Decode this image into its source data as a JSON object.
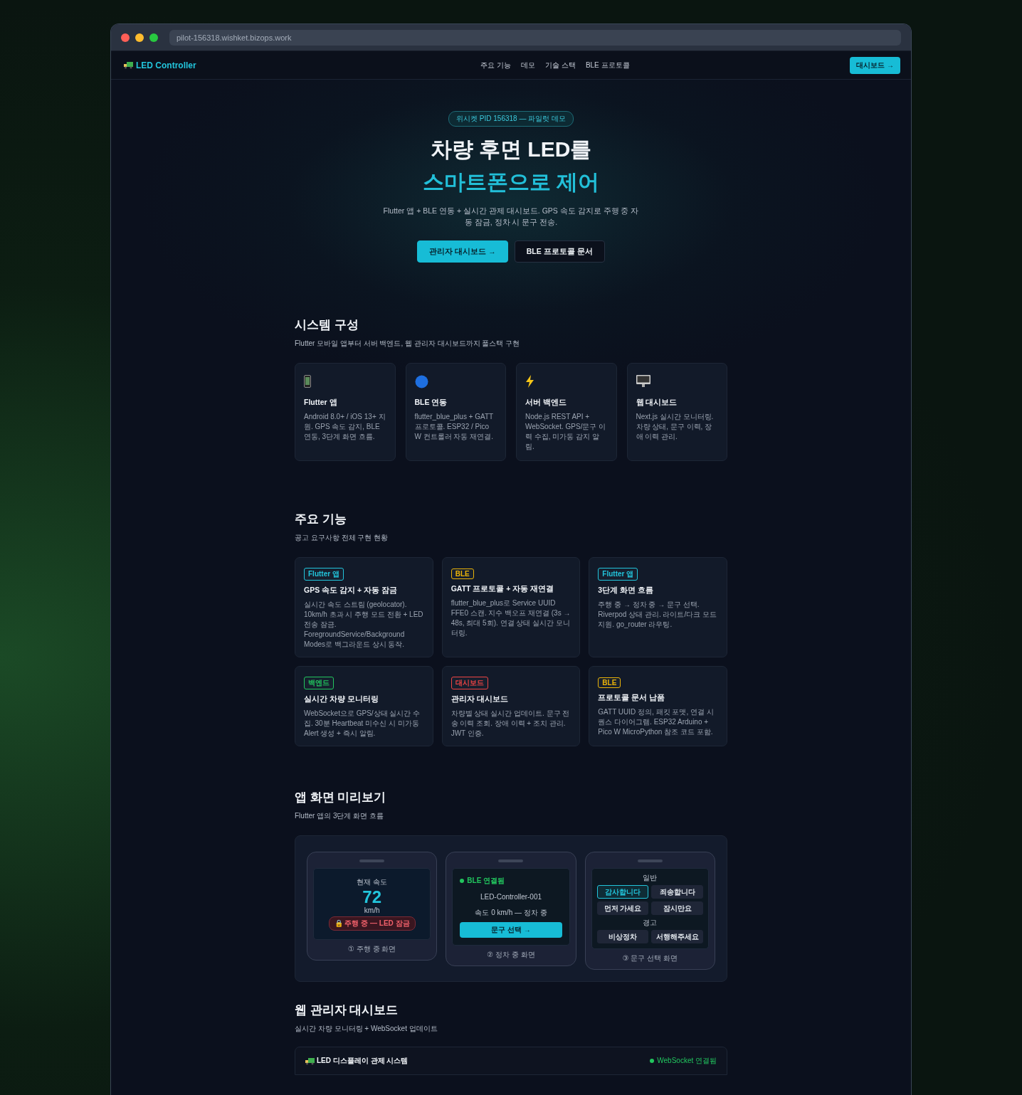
{
  "browser": {
    "url": "pilot-156318.wishket.bizops.work"
  },
  "nav": {
    "brand": "LED Controller",
    "links": [
      "주요 기능",
      "데모",
      "기술 스택",
      "BLE 프로토콜"
    ],
    "cta": "대시보드 →"
  },
  "hero": {
    "badge": "위시켓 PID 156318 — 파일럿 데모",
    "title_line1": "차량 후면 LED를",
    "title_line2": "스마트폰으로 제어",
    "description": "Flutter 앱 + BLE 연동 + 실시간 관제 대시보드. GPS 속도 감지로 주행 중 자동 잠금, 정차 시 문구 전송.",
    "buttons": [
      {
        "label": "관리자 대시보드 →",
        "kind": "primary"
      },
      {
        "label": "BLE 프로토콜 문서",
        "kind": "secondary"
      }
    ]
  },
  "system": {
    "title": "시스템 구성",
    "subtitle": "Flutter 모바일 앱부터 서버 백엔드, 웹 관리자 대시보드까지 풀스택 구현",
    "cards": [
      {
        "kind": "phone",
        "title": "Flutter 앱",
        "text": "Android 8.0+ / iOS 13+ 지원. GPS 속도 감지, BLE 연동, 3단계 화면 흐름."
      },
      {
        "kind": "bluetooth",
        "title": "BLE 연동",
        "text": "flutter_blue_plus + GATT 프로토콜. ESP32 / Pico W 컨트롤러 자동 재연결."
      },
      {
        "kind": "bolt",
        "title": "서버 백엔드",
        "text": "Node.js REST API + WebSocket. GPS/문구 이력 수집, 미가동 감지 알림."
      },
      {
        "kind": "monitor",
        "title": "웹 대시보드",
        "text": "Next.js 실시간 모니터링. 차량 상태, 문구 이력, 장애 이력 관리."
      }
    ]
  },
  "features": {
    "title": "주요 기능",
    "subtitle": "공고 요구사항 전체 구현 현황",
    "cards": [
      {
        "tag": "Flutter 앱",
        "color": "#22c5dc",
        "title": "GPS 속도 감지 + 자동 잠금",
        "text": "실시간 속도 스트림 (geolocator). 10km/h 초과 시 주행 모드 전환 + LED 전송 잠금. ForegroundService/Background Modes로 백그라운드 상시 동작."
      },
      {
        "tag": "BLE",
        "color": "#eab308",
        "title": "GATT 프로토콜 + 자동 재연결",
        "text": "flutter_blue_plus로 Service UUID FFE0 스캔. 지수 백오프 재연결 (3s → 48s, 최대 5회). 연결 상태 실시간 모니터링."
      },
      {
        "tag": "Flutter 앱",
        "color": "#22c5dc",
        "title": "3단계 화면 흐름",
        "text": "주행 중 → 정차 중 → 문구 선택. Riverpod 상태 관리. 라이트/다크 모드 지원. go_router 라우팅."
      },
      {
        "tag": "백엔드",
        "color": "#22c55e",
        "title": "실시간 차량 모니터링",
        "text": "WebSocket으로 GPS/상태 실시간 수집. 30분 Heartbeat 미수신 시 미가동 Alert 생성 + 즉시 알림."
      },
      {
        "tag": "대시보드",
        "color": "#ef4444",
        "title": "관리자 대시보드",
        "text": "차량별 상태 실시간 업데이트. 문구 전송 이력 조회. 장애 이력 + 조치 관리. JWT 인증."
      },
      {
        "tag": "BLE",
        "color": "#eab308",
        "title": "프로토콜 문서 납품",
        "text": "GATT UUID 정의, 패킷 포맷, 연결 시퀀스 다이어그램. ESP32 Arduino + Pico W MicroPython 참조 코드 포함."
      }
    ]
  },
  "preview": {
    "title": "앱 화면 미리보기",
    "subtitle": "Flutter 앱의 3단계 화면 흐름",
    "screens": [
      {
        "kind": "driving",
        "label": "① 주행 중 화면",
        "speed_label": "현재 속도",
        "speed": "72",
        "unit": "km/h",
        "lock_badge": "🔒 주행 중 — LED 잠금"
      },
      {
        "kind": "parked",
        "label": "② 정차 중 화면",
        "status": "BLE 연결됨",
        "device": "LED-Controller-001",
        "speed_text": "속도 0 km/h — 정차 중",
        "button": "문구 선택 →"
      },
      {
        "kind": "phrases",
        "label": "③ 문구 선택 화면",
        "groups": [
          {
            "title": "일반",
            "phrases": [
              {
                "text": "감사합니다",
                "selected": true
              },
              {
                "text": "죄송합니다",
                "selected": false
              },
              {
                "text": "먼저 가세요",
                "selected": false
              },
              {
                "text": "잠시만요",
                "selected": false
              }
            ]
          },
          {
            "title": "경고",
            "phrases": [
              {
                "text": "비상정차",
                "selected": false
              },
              {
                "text": "서행해주세요",
                "selected": false
              }
            ]
          }
        ]
      }
    ]
  },
  "dashboard": {
    "title": "웹 관리자 대시보드",
    "subtitle": "실시간 차량 모니터링 + WebSocket 업데이트",
    "panel_title": "LED 디스플레이 관제 시스템",
    "connection": "WebSocket 연결됨"
  }
}
